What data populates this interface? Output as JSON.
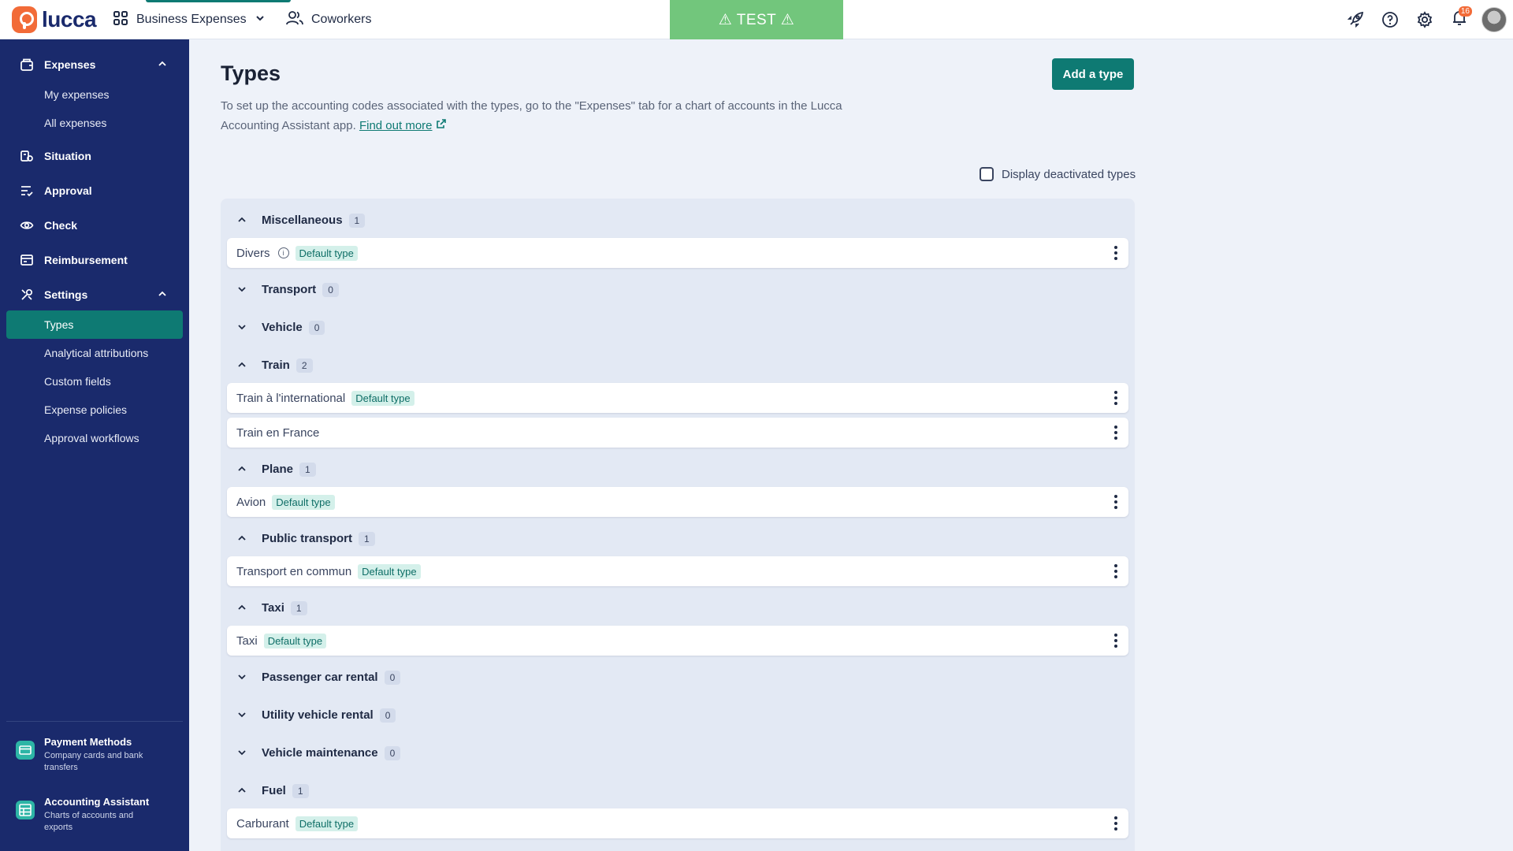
{
  "topbar": {
    "logo_text": "lucca",
    "app_name": "Business Expenses",
    "coworkers": "Coworkers",
    "test_banner": "⚠ TEST ⚠",
    "notification_count": "16"
  },
  "sidebar": {
    "expenses": "Expenses",
    "my_expenses": "My expenses",
    "all_expenses": "All expenses",
    "situation": "Situation",
    "approval": "Approval",
    "check": "Check",
    "reimbursement": "Reimbursement",
    "settings": "Settings",
    "settings_items": [
      "Types",
      "Analytical attributions",
      "Custom fields",
      "Expense policies",
      "Approval workflows"
    ],
    "tools": [
      {
        "title": "Payment Methods",
        "desc": "Company cards and bank transfers"
      },
      {
        "title": "Accounting Assistant",
        "desc": "Charts of accounts and exports"
      }
    ]
  },
  "main": {
    "title": "Types",
    "add_button": "Add a type",
    "intro": "To set up the accounting codes associated with the types, go to the \"Expenses\" tab for a chart of accounts in the Lucca Accounting Assistant app.",
    "find_out_more": "Find out more",
    "display_deactivated": "Display deactivated types",
    "default_tag": "Default type"
  },
  "categories": [
    {
      "name": "Miscellaneous",
      "count": "1",
      "expanded": true,
      "items": [
        {
          "name": "Divers",
          "info": true,
          "default": true
        }
      ]
    },
    {
      "name": "Transport",
      "count": "0",
      "expanded": false,
      "items": []
    },
    {
      "name": "Vehicle",
      "count": "0",
      "expanded": false,
      "items": []
    },
    {
      "name": "Train",
      "count": "2",
      "expanded": true,
      "items": [
        {
          "name": "Train à l'international",
          "default": true
        },
        {
          "name": "Train en France",
          "default": false
        }
      ]
    },
    {
      "name": "Plane",
      "count": "1",
      "expanded": true,
      "items": [
        {
          "name": "Avion",
          "default": true
        }
      ]
    },
    {
      "name": "Public transport",
      "count": "1",
      "expanded": true,
      "items": [
        {
          "name": "Transport en commun",
          "default": true
        }
      ]
    },
    {
      "name": "Taxi",
      "count": "1",
      "expanded": true,
      "items": [
        {
          "name": "Taxi",
          "default": true
        }
      ]
    },
    {
      "name": "Passenger car rental",
      "count": "0",
      "expanded": false,
      "items": []
    },
    {
      "name": "Utility vehicle rental",
      "count": "0",
      "expanded": false,
      "items": []
    },
    {
      "name": "Vehicle maintenance",
      "count": "0",
      "expanded": false,
      "items": []
    },
    {
      "name": "Fuel",
      "count": "1",
      "expanded": true,
      "items": [
        {
          "name": "Carburant",
          "default": true
        }
      ]
    }
  ],
  "colors": {
    "sidebar_bg": "#1a2a6c",
    "accent": "#0e7a73",
    "test_banner": "#72c67c",
    "page_bg": "#eef2f9"
  }
}
